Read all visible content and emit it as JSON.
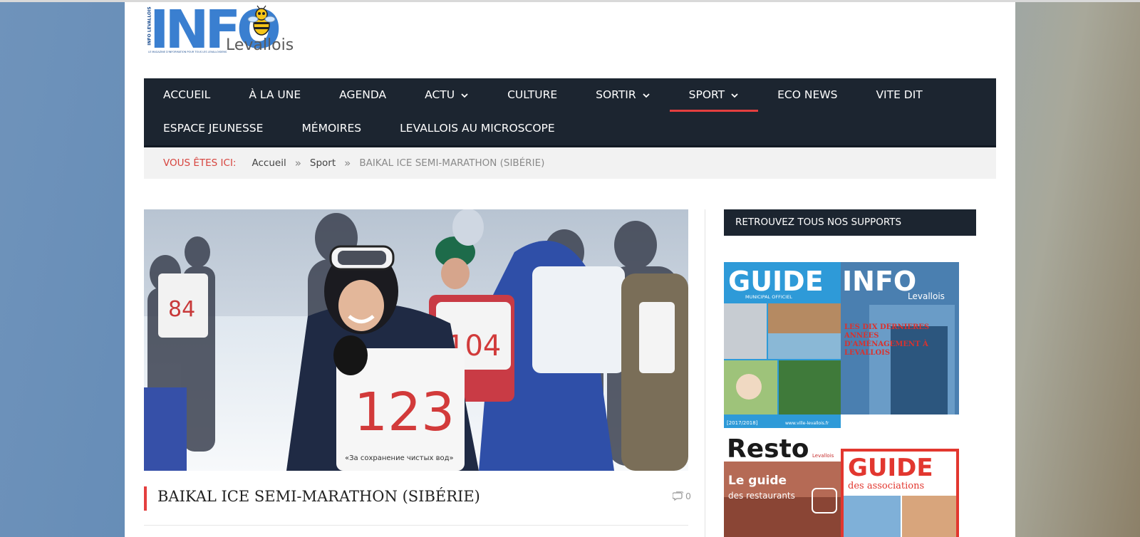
{
  "logo": {
    "main": "INFO",
    "town": "Levallois",
    "vertical": "INFO LEVALLOIS",
    "tagline": "LE MAGAZINE D'INFORMATION POUR TOUS LES LEVALLOISIENS"
  },
  "nav": {
    "row1": [
      {
        "label": "ACCUEIL"
      },
      {
        "label": "À LA UNE"
      },
      {
        "label": "AGENDA"
      },
      {
        "label": "ACTU",
        "dropdown": true
      },
      {
        "label": "CULTURE"
      },
      {
        "label": "SORTIR",
        "dropdown": true
      },
      {
        "label": "SPORT",
        "dropdown": true,
        "active": true
      },
      {
        "label": "ECO NEWS"
      },
      {
        "label": "VITE DIT"
      }
    ],
    "row2": [
      {
        "label": "ESPACE JEUNESSE"
      },
      {
        "label": "MÉMOIRES"
      },
      {
        "label": "LEVALLOIS AU MICROSCOPE"
      }
    ]
  },
  "breadcrumb": {
    "label": "VOUS ÊTES ICI:",
    "items": [
      "Accueil",
      "Sport"
    ],
    "separator": "»",
    "current": "BAIKAL ICE SEMI-MARATHON (SIBÉRIE)"
  },
  "hero": {
    "bib_numbers": [
      "123",
      "104",
      "84"
    ],
    "bib_slogan": "«За сохранение чистых вод»"
  },
  "post": {
    "title": "BAIKAL ICE SEMI-MARATHON (SIBÉRIE)",
    "comment_count": "0"
  },
  "sidebar": {
    "widget_title": "RETROUVEZ TOUS NOS SUPPORTS",
    "covers": {
      "guide_municipal": {
        "title": "GUIDE",
        "subtitle": "MUNICIPAL OFFICIEL",
        "year": "[2017/2018]",
        "url": "www.ville-levallois.fr"
      },
      "info_levallois": {
        "title": "INFO",
        "town": "Levallois",
        "headline": "LES DIX DERNIÈRES ANNÉES D'AMÉNAGEMENT À LEVALLOIS"
      },
      "resto": {
        "title": "Resto",
        "town": "Levallois",
        "line1": "Le guide",
        "line2": "des restaurants"
      },
      "guide_assoc": {
        "title": "GUIDE",
        "subtitle": "des associations"
      }
    }
  },
  "colors": {
    "nav_bg": "#1c2530",
    "accent": "#e43f3f",
    "breadcrumb_label": "#d7443e",
    "logo_blue": "#3a7fd0"
  }
}
